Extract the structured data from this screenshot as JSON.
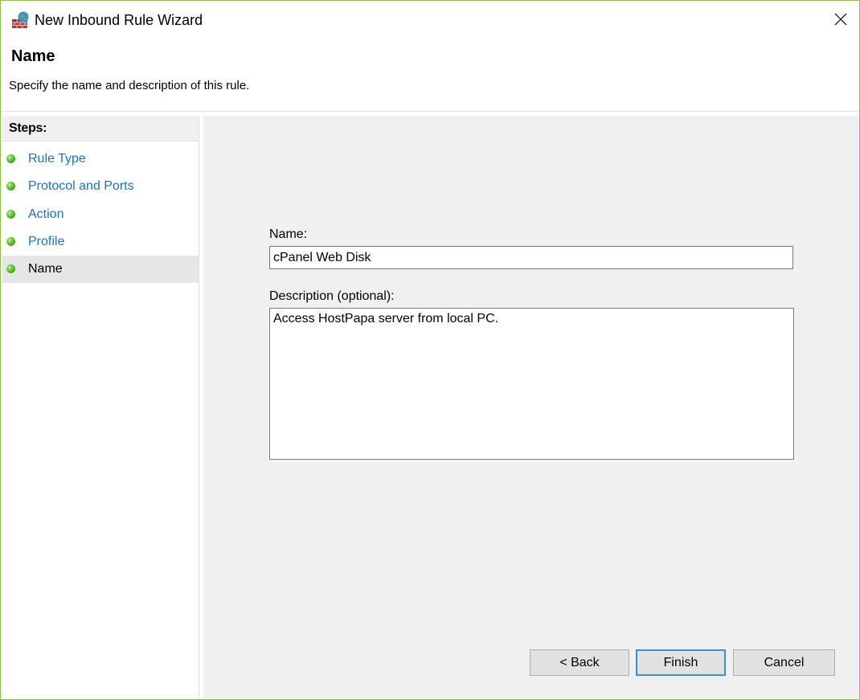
{
  "window": {
    "title": "New Inbound Rule Wizard",
    "close_glyph": "✕"
  },
  "header": {
    "title": "Name",
    "subtitle": "Specify the name and description of this rule."
  },
  "steps": {
    "heading": "Steps:",
    "items": [
      {
        "label": "Rule Type",
        "state": "completed"
      },
      {
        "label": "Protocol and Ports",
        "state": "completed"
      },
      {
        "label": "Action",
        "state": "completed"
      },
      {
        "label": "Profile",
        "state": "completed"
      },
      {
        "label": "Name",
        "state": "current"
      }
    ]
  },
  "form": {
    "name_label": "Name:",
    "name_value": "cPanel Web Disk",
    "description_label": "Description (optional):",
    "description_value": "Access HostPapa server from local PC."
  },
  "buttons": {
    "back": "< Back",
    "finish": "Finish",
    "cancel": "Cancel"
  },
  "colors": {
    "link": "#1a73c8",
    "focus_border": "#3d8fd6",
    "window_border": "#8cc34a",
    "step_dot": "#5cc02d"
  }
}
